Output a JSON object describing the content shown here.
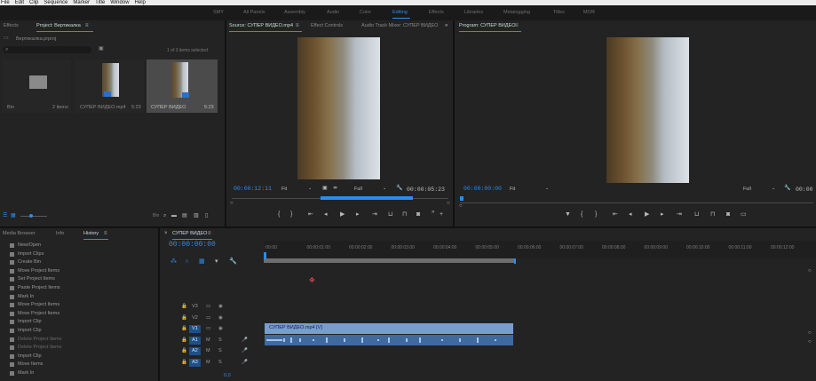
{
  "menu": [
    "File",
    "Edit",
    "Clip",
    "Sequence",
    "Marker",
    "Title",
    "Window",
    "Help"
  ],
  "workspaces": [
    {
      "label": "SMY",
      "active": false
    },
    {
      "label": "All Panels",
      "active": false
    },
    {
      "label": "Assembly",
      "active": false
    },
    {
      "label": "Audio",
      "active": false
    },
    {
      "label": "Color",
      "active": false
    },
    {
      "label": "Editing",
      "active": true
    },
    {
      "label": "Effects",
      "active": false
    },
    {
      "label": "Libraries",
      "active": false
    },
    {
      "label": "Metalogging",
      "active": false
    },
    {
      "label": "Titles",
      "active": false
    },
    {
      "label": "МОЯ",
      "active": false
    }
  ],
  "project_panel": {
    "tabs": [
      "Effects",
      "Project: Вертикалка"
    ],
    "project_file": "Вертикалка.prproj",
    "search_placeholder": "",
    "selection_info": "1 of 3 items selected",
    "items": [
      {
        "name": "Bin",
        "meta": "2 items"
      },
      {
        "name": "СУПЕР ВИДЕО.mp4",
        "meta": "5:23"
      },
      {
        "name": "СУПЕР ВИДЕО",
        "meta": "5:23"
      }
    ]
  },
  "source_panel": {
    "tabs": [
      "Source: СУПЕР ВИДЕО.mp4",
      "Effect Controls",
      "Audio Track Mixer: СУПЕР ВИДЕО"
    ],
    "timecode_left": "00:00:12:11",
    "fit": "Fit",
    "quality": "Full",
    "timecode_right": "00:00:05:23"
  },
  "program_panel": {
    "title": "Program: СУПЕР ВИДЕО",
    "timecode_left": "00:00:00:00",
    "fit": "Fit",
    "quality": "Full",
    "timecode_right": "00:00"
  },
  "history_panel": {
    "tabs": [
      "Media Browser",
      "Info",
      "History"
    ],
    "items": [
      "New/Open",
      "Import Clips",
      "Create Bin",
      "Move Project Items",
      "Set Project Items",
      "Paste Project Items",
      "Mark In",
      "Move Project Items",
      "Move Project Items",
      "Import Clip",
      "Import Clip",
      "Delete Project Items",
      "Delete Project Items",
      "Import Clip",
      "Move Items",
      "Mark In"
    ]
  },
  "timeline": {
    "tab": "СУПЕР ВИДЕО",
    "timecode": "00:00:00:00",
    "ruler": [
      ":00:00",
      "00:00:01:00",
      "00:00:02:00",
      "00:00:03:00",
      "00:00:04:00",
      "00:00:05:00",
      "00:00:06:00",
      "00:00:07:00",
      "00:00:08:00",
      "00:00:09:00",
      "00:00:10:00",
      "00:00:11:00",
      "00:00:12:00"
    ],
    "tracks": [
      "V3",
      "V2",
      "V1",
      "A1",
      "A2",
      "A3"
    ],
    "clip_video_label": "СУПЕР ВИДЕО.mp4 [V]",
    "bottom_value": "0.0"
  },
  "colors": {
    "accent": "#2d8ceb",
    "clip_video": "#7a9ccf",
    "clip_audio": "#3f6a9f"
  }
}
